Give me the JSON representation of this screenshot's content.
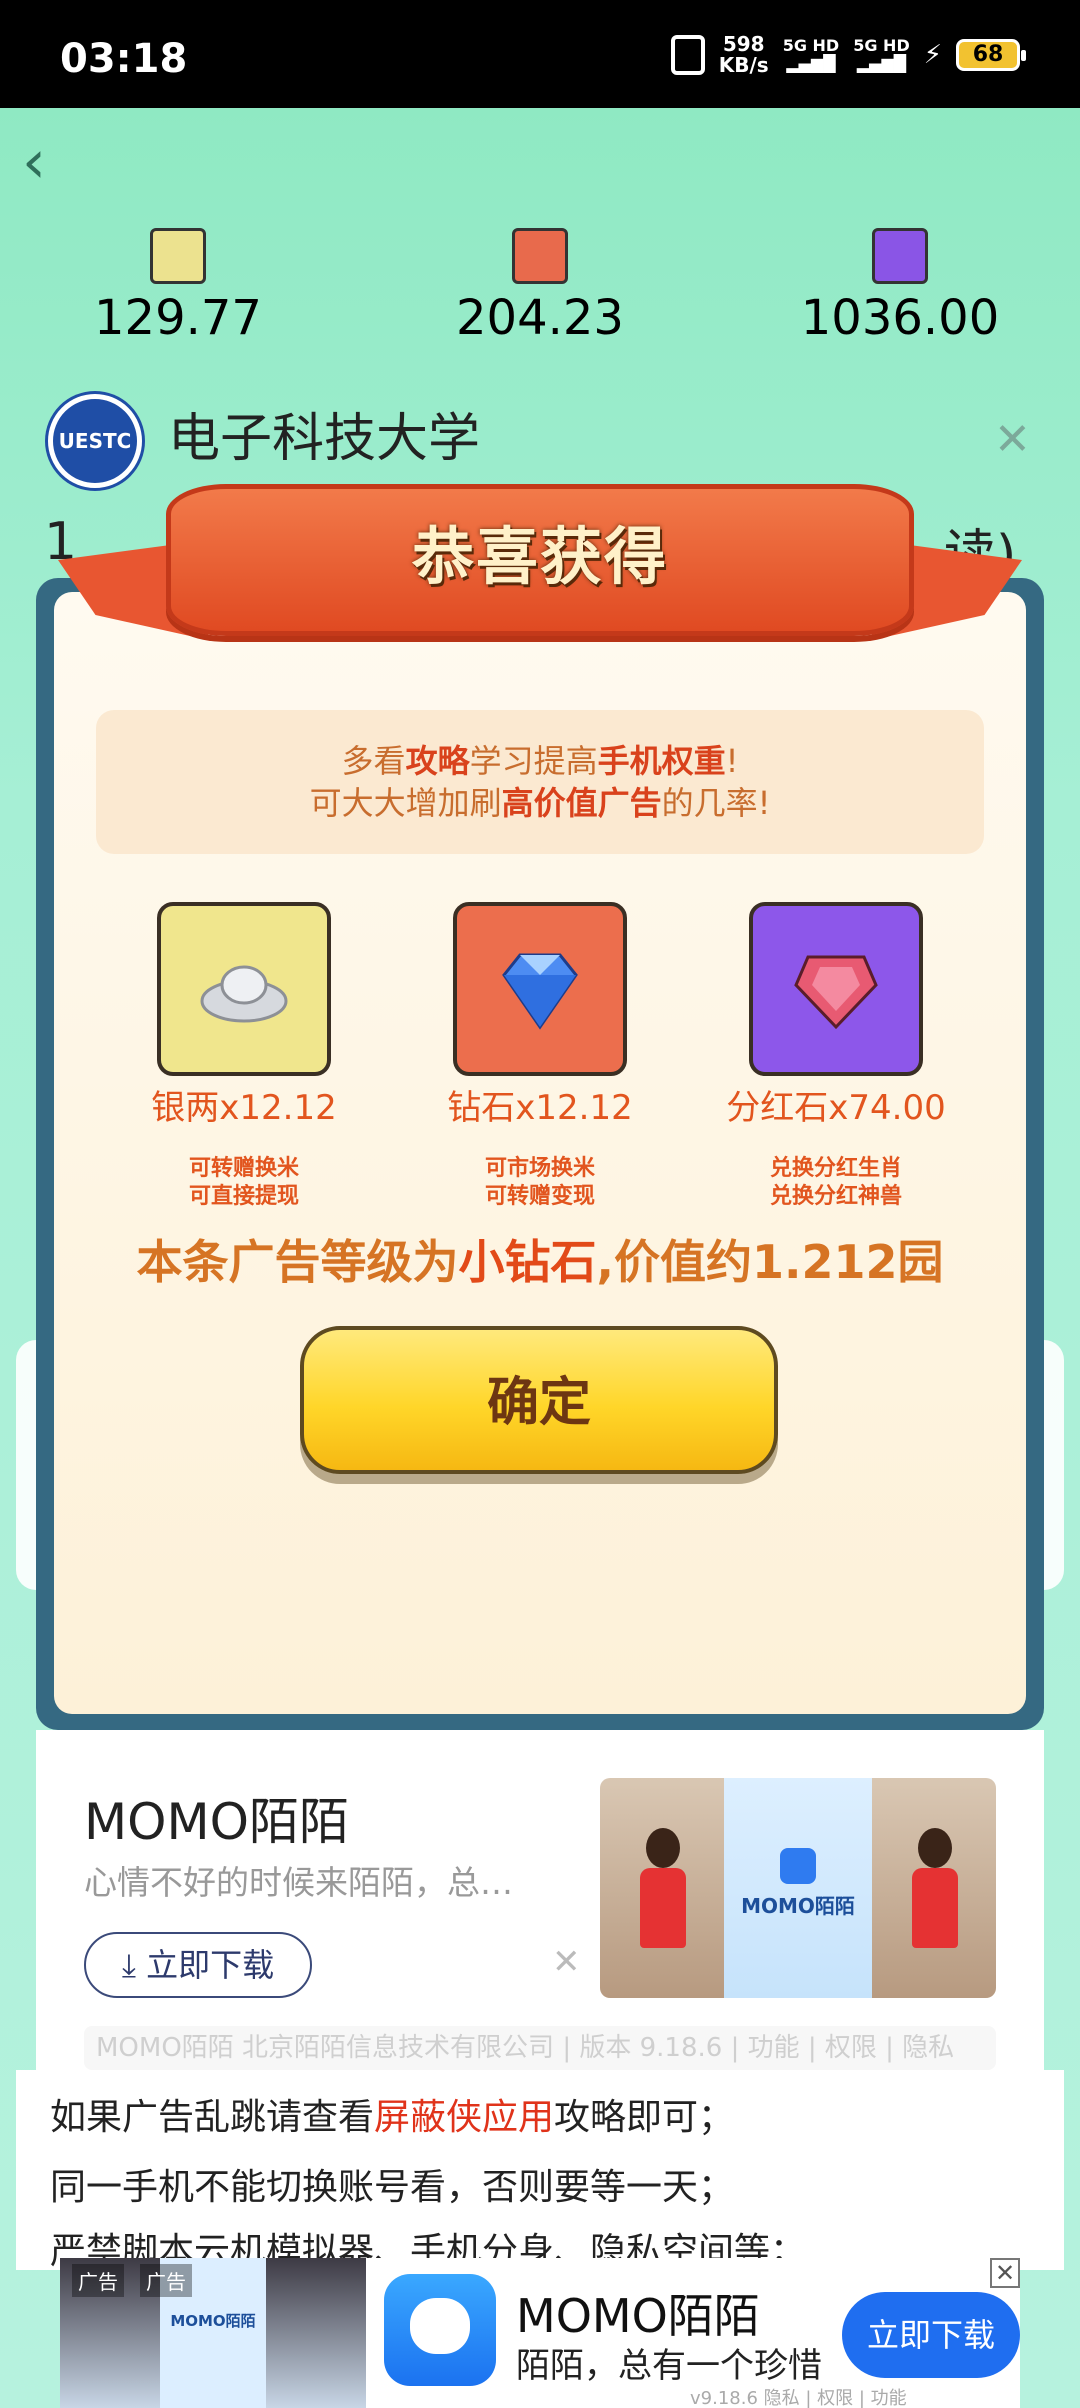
{
  "status_bar": {
    "time": "03:18",
    "net_speed_value": "598",
    "net_speed_unit": "KB/s",
    "signal1": "5G HD",
    "signal2": "5G HD",
    "battery": "68"
  },
  "balances": [
    {
      "value": "129.77",
      "icon": "silver-ingot-icon"
    },
    {
      "value": "204.23",
      "icon": "diamond-icon"
    },
    {
      "value": "1036.00",
      "icon": "red-gem-icon"
    }
  ],
  "background": {
    "university_logo_text": "UESTC",
    "university_name": "电子科技大学",
    "line_start": "1",
    "line_end": "读)"
  },
  "dialog": {
    "title": "恭喜获得",
    "tip_line1": [
      "多看",
      "攻略",
      "学习提高",
      "手机权重",
      "!"
    ],
    "tip_line2": [
      "可大大增加刷",
      "高价值广告",
      "的几率!"
    ],
    "rewards": [
      {
        "name": "银两x12.12",
        "desc1": "可转赠换米",
        "desc2": "可直接提现",
        "icon": "silver-ingot-icon"
      },
      {
        "name": "钻石x12.12",
        "desc1": "可市场换米",
        "desc2": "可转赠变现",
        "icon": "diamond-icon"
      },
      {
        "name": "分红石x74.00",
        "desc1": "兑换分红生肖",
        "desc2": "兑换分红神兽",
        "icon": "red-gem-icon"
      }
    ],
    "value_prefix": "本条广告等级为",
    "value_level": "小钻石",
    "value_suffix": ",价值约1.212园",
    "ok_label": "确定"
  },
  "ad_card": {
    "title": "MOMO陌陌",
    "subtitle": "心情不好的时候来陌陌，总…",
    "download_label": "立即下载",
    "image_text": "MOMO陌陌",
    "meta": "MOMO陌陌 北京陌陌信息技术有限公司 | 版本 9.18.6 | 功能 | 权限 | 隐私"
  },
  "article": {
    "line1_a": "如果广告乱跳请查看",
    "line1_b": "屏蔽侠应用",
    "line1_c": "攻略即可；",
    "line2": "同一手机不能切换账号看，否则要等一天；",
    "line3": "严禁脚本云机模拟器、手机分身、隐私空间等；"
  },
  "banner_ad": {
    "tag1": "广告",
    "tag2": "广告",
    "image_text": "MOMO陌陌",
    "title": "MOMO陌陌",
    "subtitle": "陌陌，总有一个珍惜",
    "button_label": "立即下载",
    "meta": "v9.18.6 隐私 | 权限 | 功能"
  },
  "colors": {
    "accent_orange": "#e2551e",
    "ribbon": "#e85631",
    "button_yellow": "#ffd629",
    "download_blue": "#1f6ef0"
  }
}
